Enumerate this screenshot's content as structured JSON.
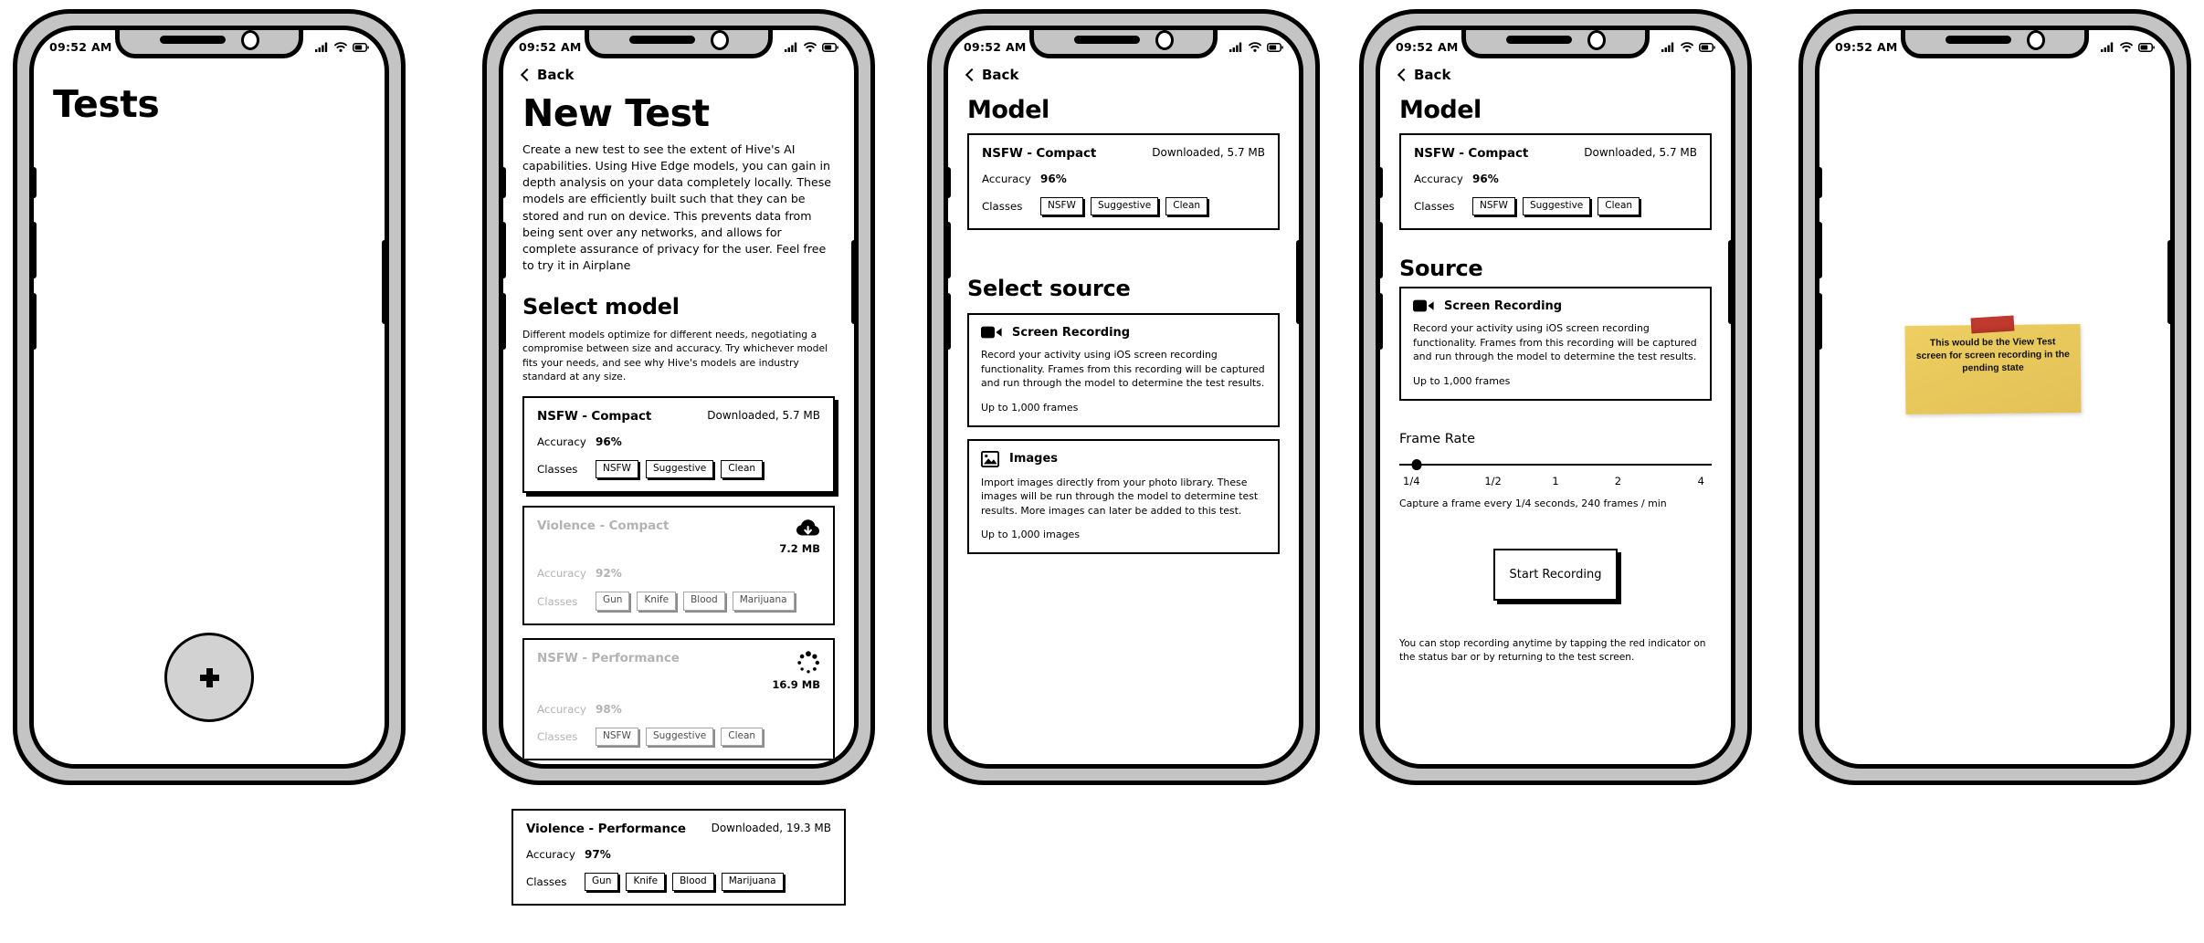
{
  "status_bar": {
    "time": "09:52 AM",
    "icons": [
      "cellular-icon",
      "wifi-icon",
      "battery-icon"
    ]
  },
  "common": {
    "back_label": "Back",
    "accuracy_label": "Accuracy",
    "classes_label": "Classes"
  },
  "screens": [
    {
      "id": "tests",
      "title": "Tests",
      "fab_label": "+"
    },
    {
      "id": "new-test",
      "back_label": "Back",
      "title": "New Test",
      "intro": "Create a new test to see the extent of Hive's AI capabilities. Using Hive Edge models, you can gain in depth analysis on your data completely locally. These models are efficiently built such that they can be stored and run on device. This prevents data from being sent over any networks, and allows for complete assurance of privacy for the user. Feel free to try it in Airplane",
      "section_title": "Select model",
      "section_desc": "Different models optimize for different needs, negotiating a compromise between size and accuracy. Try whichever model fits your needs, and see why Hive's models are industry standard at any size.",
      "models": [
        {
          "name": "NSFW - Compact",
          "status": "Downloaded, 5.7 MB",
          "accuracy": "96%",
          "classes": [
            "NSFW",
            "Suggestive",
            "Clean"
          ],
          "state": "downloaded"
        },
        {
          "name": "Violence - Compact",
          "size": "7.2 MB",
          "accuracy": "92%",
          "classes": [
            "Gun",
            "Knife",
            "Blood",
            "Marijuana"
          ],
          "state": "available",
          "icon": "cloud-download-icon"
        },
        {
          "name": "NSFW - Performance",
          "size": "16.9 MB",
          "accuracy": "98%",
          "classes": [
            "NSFW",
            "Suggestive",
            "Clean"
          ],
          "state": "downloading",
          "icon": "spinner-icon"
        },
        {
          "name": "Violence - Performance",
          "status": "Downloaded, 19.3 MB",
          "accuracy": "97%",
          "classes": [
            "Gun",
            "Knife",
            "Blood",
            "Marijuana"
          ],
          "state": "downloaded"
        }
      ]
    },
    {
      "id": "select-source",
      "back_label": "Back",
      "title": "Model",
      "model": {
        "name": "NSFW - Compact",
        "status": "Downloaded, 5.7 MB",
        "accuracy": "96%",
        "classes": [
          "NSFW",
          "Suggestive",
          "Clean"
        ]
      },
      "section_title": "Select source",
      "sources": [
        {
          "icon": "video-camera-icon",
          "title": "Screen Recording",
          "desc": "Record your activity using iOS screen recording functionality. Frames from this recording will be captured and run through the model to determine the test results.",
          "limit": "Up to 1,000 frames"
        },
        {
          "icon": "photo-image-icon",
          "title": "Images",
          "desc": "Import images directly from your photo library. These images will be run through the model to determine test results. More images can later be added to this test.",
          "limit": "Up to 1,000 images"
        }
      ]
    },
    {
      "id": "frame-rate",
      "back_label": "Back",
      "title": "Model",
      "model": {
        "name": "NSFW - Compact",
        "status": "Downloaded, 5.7 MB",
        "accuracy": "96%",
        "classes": [
          "NSFW",
          "Suggestive",
          "Clean"
        ]
      },
      "section_title": "Source",
      "source": {
        "icon": "video-camera-icon",
        "title": "Screen Recording",
        "desc": "Record your activity using iOS screen recording functionality. Frames from this recording will be captured and run through the model to determine the test results.",
        "limit": "Up to 1,000 frames"
      },
      "frame_rate": {
        "label": "Frame Rate",
        "ticks": [
          "1/4",
          "1/2",
          "1",
          "2",
          "4"
        ],
        "selected": "1/4",
        "caption": "Capture a frame every 1/4 seconds, 240 frames / min"
      },
      "start_button": "Start Recording",
      "footnote": "You can stop recording anytime by tapping the red indicator on the status bar or by returning to the test screen."
    },
    {
      "id": "view-test-pending",
      "sticky_note": "This would be the View Test screen for screen recording in the pending state"
    }
  ]
}
